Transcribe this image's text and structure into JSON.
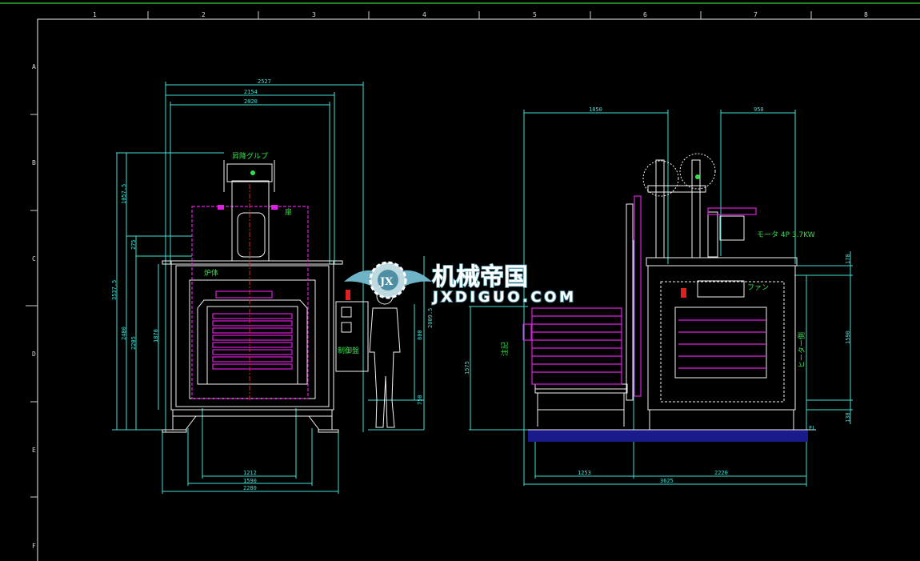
{
  "border": {
    "columns": [
      "1",
      "2",
      "3",
      "4",
      "5",
      "6",
      "7",
      "8"
    ],
    "rows": [
      "A",
      "B",
      "C",
      "D",
      "E",
      "F"
    ]
  },
  "front_view": {
    "dims_top": [
      "2527",
      "2154",
      "2020"
    ],
    "dims_left": [
      "1057.5",
      "275",
      "3537.5",
      "2480",
      "2205",
      "1870"
    ],
    "dims_right": [
      "2009.5",
      "800",
      "750"
    ],
    "dims_bottom": [
      "1212",
      "1590",
      "2280"
    ],
    "labels": {
      "lift_group": "昇降グルプ",
      "door": "扉",
      "furnace_body": "炉体",
      "control_panel": "制御盤"
    }
  },
  "side_view": {
    "dims_top": [
      "1850",
      "950"
    ],
    "dims_left": [
      "1575"
    ],
    "dims_right": [
      "170",
      "1590",
      "138"
    ],
    "dims_bottom": [
      "1253",
      "2220",
      "3625"
    ],
    "labels": {
      "motor": "モータ 4P 3.7KW",
      "fan": "ファン",
      "note": "注記",
      "heater": "ヒーター側",
      "floor_level": "FL"
    }
  },
  "watermark": {
    "title": "机械帝国",
    "url": "JXDIGUO.COM",
    "logo_text": "JX"
  },
  "colors": {
    "dimension": "#3fe0d8",
    "outline": "#f2f2f2",
    "magenta": "#e020e0",
    "label": "#35e04a",
    "centerline": "#e02020"
  }
}
